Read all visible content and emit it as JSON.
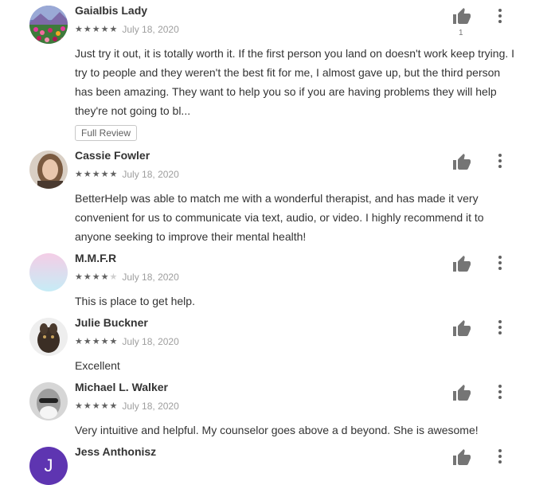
{
  "reviews": [
    {
      "name": "GaiaIbis Lady",
      "stars": 5,
      "date": "July 18, 2020",
      "text": "Just try it out, it is totally worth it. If the first person you land on doesn't work keep trying. I try to people and they weren't the best fit for me, I almost gave up, but the third person has been amazing. They want to help you so if you are having problems they will help they're not going to bl...",
      "helpful_count": "1",
      "full_review_label": "Full Review"
    },
    {
      "name": "Cassie Fowler",
      "stars": 5,
      "date": "July 18, 2020",
      "text": "BetterHelp was able to match me with a wonderful therapist, and has made it very convenient for us to communicate via text, audio, or video. I highly recommend it to anyone seeking to improve their mental health!"
    },
    {
      "name": "M.M.F.R",
      "stars": 4,
      "date": "July 18, 2020",
      "text": "This is place to get help."
    },
    {
      "name": "Julie Buckner",
      "stars": 5,
      "date": "July 18, 2020",
      "text": "Excellent"
    },
    {
      "name": "Michael L. Walker",
      "stars": 5,
      "date": "July 18, 2020",
      "text": "Very intuitive and helpful. My counselor goes above a d beyond. She is awesome!"
    },
    {
      "name": "Jess Anthonisz",
      "avatar_letter": "J",
      "avatar_color": "#5e35b1"
    }
  ],
  "icons": {
    "helpful": "thumb-up-icon",
    "menu": "more-vert-icon",
    "rating": "star-icon"
  },
  "colors": {
    "star_filled": "#616161",
    "star_empty": "#cfcfcf"
  }
}
